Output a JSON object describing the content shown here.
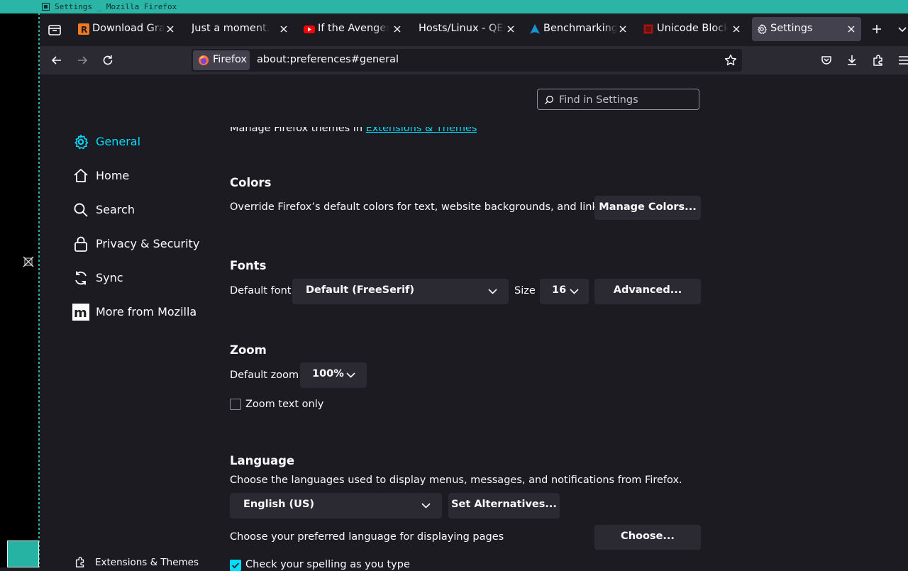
{
  "window": {
    "title": "Settings _ Mozilla Firefox"
  },
  "tabs": [
    {
      "label": "Download Gran",
      "favicon": "rust-icon"
    },
    {
      "label": "Just a moment...",
      "favicon": "none"
    },
    {
      "label": "If the Avengers",
      "favicon": "youtube-icon"
    },
    {
      "label": "Hosts/Linux - QEMU",
      "favicon": "none"
    },
    {
      "label": "Benchmarking",
      "favicon": "arch-icon"
    },
    {
      "label": "Unicode Block",
      "favicon": "unicode-icon"
    },
    {
      "label": "Settings",
      "favicon": "gear-icon",
      "active": true
    }
  ],
  "urlbar": {
    "identity_label": "Firefox",
    "url": "about:preferences#general"
  },
  "search": {
    "placeholder": "Find in Settings"
  },
  "categories": [
    {
      "label": "General",
      "icon": "gear-icon",
      "selected": true
    },
    {
      "label": "Home",
      "icon": "home-icon"
    },
    {
      "label": "Search",
      "icon": "search-icon"
    },
    {
      "label": "Privacy & Security",
      "icon": "lock-icon"
    },
    {
      "label": "Sync",
      "icon": "sync-icon"
    },
    {
      "label": "More from Mozilla",
      "icon": "mozilla-icon"
    }
  ],
  "footer_category": {
    "label": "Extensions & Themes",
    "icon": "puzzle-icon"
  },
  "themes_note": {
    "text": "Manage Firefox themes in ",
    "link": "Extensions & Themes"
  },
  "colors": {
    "heading": "Colors",
    "description": "Override Firefox’s default colors for text, website backgrounds, and links.",
    "button": "Manage Colors..."
  },
  "fonts": {
    "heading": "Fonts",
    "default_font_label": "Default font",
    "default_font_value": "Default (FreeSerif)",
    "size_label": "Size",
    "size_value": "16",
    "advanced_button": "Advanced..."
  },
  "zoom": {
    "heading": "Zoom",
    "default_zoom_label": "Default zoom",
    "default_zoom_value": "100%",
    "text_only_label": "Zoom text only",
    "text_only_checked": false
  },
  "language": {
    "heading": "Language",
    "description": "Choose the languages used to display menus, messages, and notifications from Firefox.",
    "selected": "English (US)",
    "alternatives_button": "Set Alternatives...",
    "pages_label": "Choose your preferred language for displaying pages",
    "choose_button": "Choose...",
    "spellcheck_label": "Check your spelling as you type",
    "spellcheck_checked": true
  },
  "theme_colors": {
    "accent": "#00ddff",
    "background": "#1c1b22",
    "surface": "#2b2a33",
    "titlebar": "#2bb5a6"
  }
}
